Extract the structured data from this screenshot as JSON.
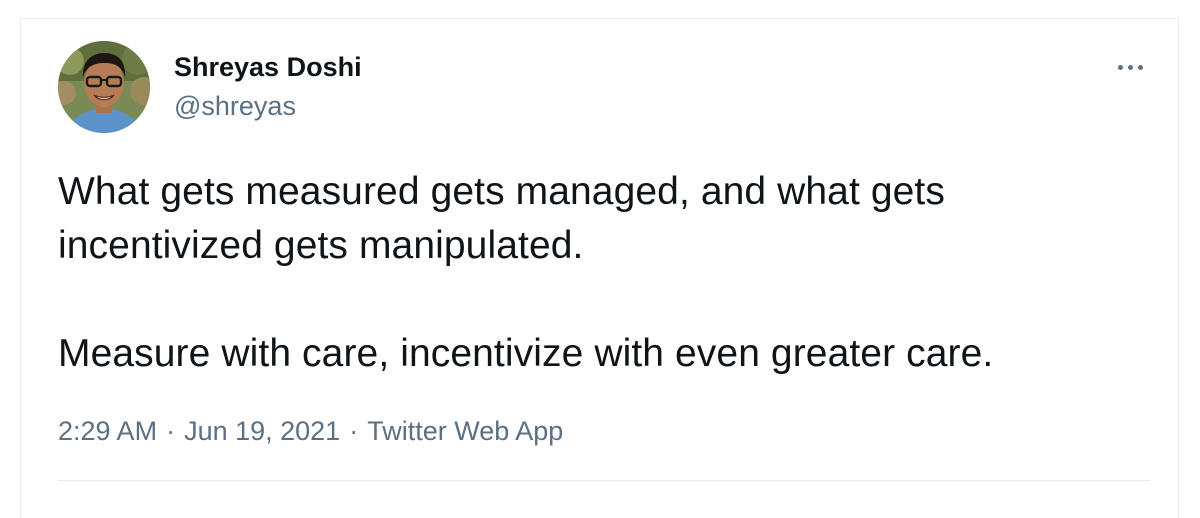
{
  "tweet": {
    "author": {
      "display_name": "Shreyas Doshi",
      "handle": "@shreyas"
    },
    "text": {
      "paragraph_1": "What gets measured gets managed, and what gets incentivized gets manipulated.",
      "paragraph_2": "Measure with care, incentivize with even greater care."
    },
    "meta": {
      "time": "2:29 AM",
      "separator": "·",
      "date": "Jun 19, 2021",
      "source": "Twitter Web App"
    },
    "more_icon": "more-dots-icon"
  },
  "colors": {
    "text_primary": "#0f1419",
    "text_secondary": "#5b7083",
    "border": "#e6ecf0",
    "background": "#ffffff"
  }
}
